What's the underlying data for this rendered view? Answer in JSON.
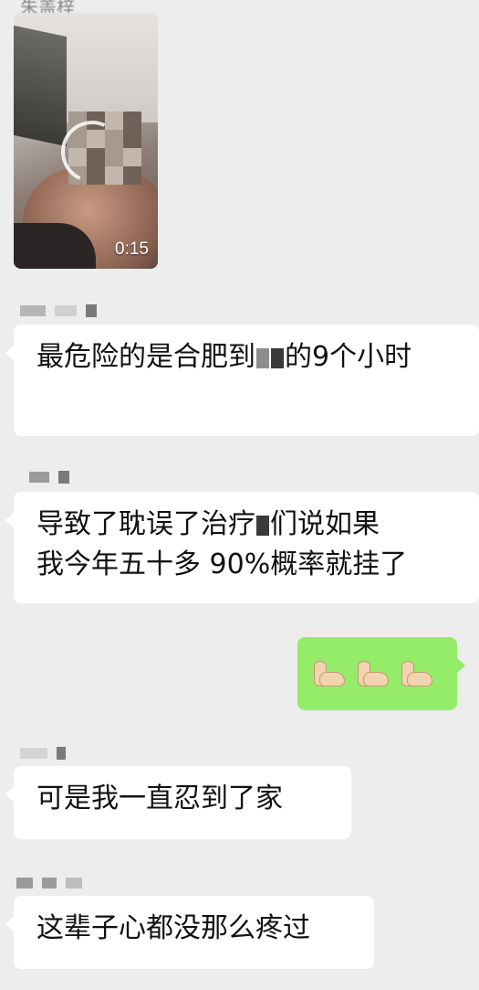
{
  "chat": {
    "top_sender": "朱盖梓",
    "video": {
      "duration": "0:15",
      "icon": "rotate-icon"
    },
    "messages": [
      {
        "direction": "in",
        "text_a": "最危险的是合肥到",
        "text_b": "的9个小时"
      },
      {
        "direction": "in",
        "text_a": "导致了耽误了治疗",
        "text_b": "们说如果",
        "text_c": "我今年五十多 90%概率就挂了"
      },
      {
        "direction": "out",
        "emoji": "💪💪💪"
      },
      {
        "direction": "in",
        "text": "可是我一直忍到了家"
      },
      {
        "direction": "in",
        "text": "这辈子心都没那么疼过"
      }
    ]
  },
  "colors": {
    "background": "#ededed",
    "incoming_bubble": "#ffffff",
    "outgoing_bubble": "#95ec69"
  }
}
